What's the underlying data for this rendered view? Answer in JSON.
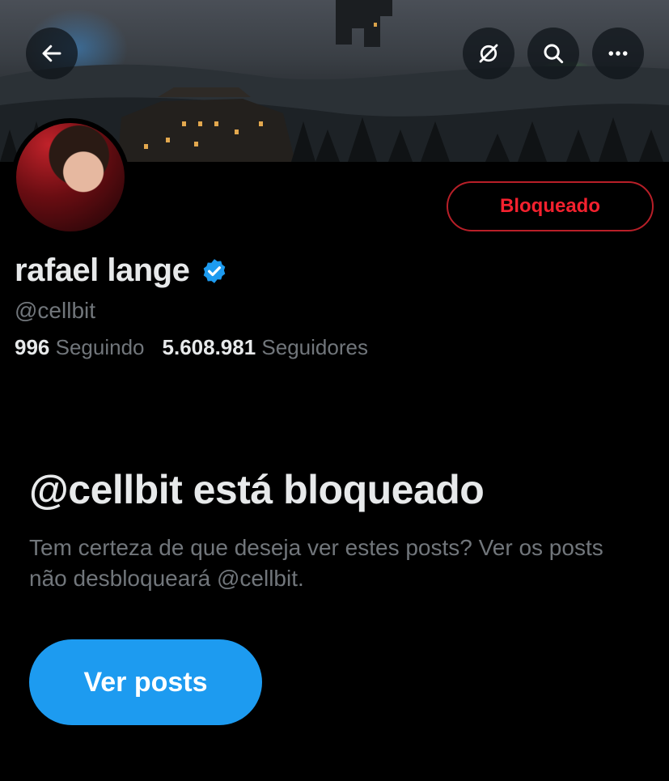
{
  "header": {
    "back_icon": "arrow-left-icon",
    "unfollow_icon": "no-sync-icon",
    "search_icon": "search-icon",
    "more_icon": "more-horizontal-icon"
  },
  "profile": {
    "display_name": "rafael lange",
    "handle": "@cellbit",
    "verified": true,
    "blocked_label": "Bloqueado",
    "following_count": "996",
    "following_label": "Seguindo",
    "followers_count": "5.608.981",
    "followers_label": "Seguidores"
  },
  "blocked_notice": {
    "title": "@cellbit está bloqueado",
    "description": "Tem certeza de que deseja ver estes posts? Ver os posts não desbloqueará @cellbit.",
    "view_posts_label": "Ver posts"
  },
  "colors": {
    "background": "#000000",
    "accent": "#1d9bf0",
    "blocked_red": "#f4212e",
    "muted_text": "#71767b",
    "text": "#e7e9ea"
  }
}
